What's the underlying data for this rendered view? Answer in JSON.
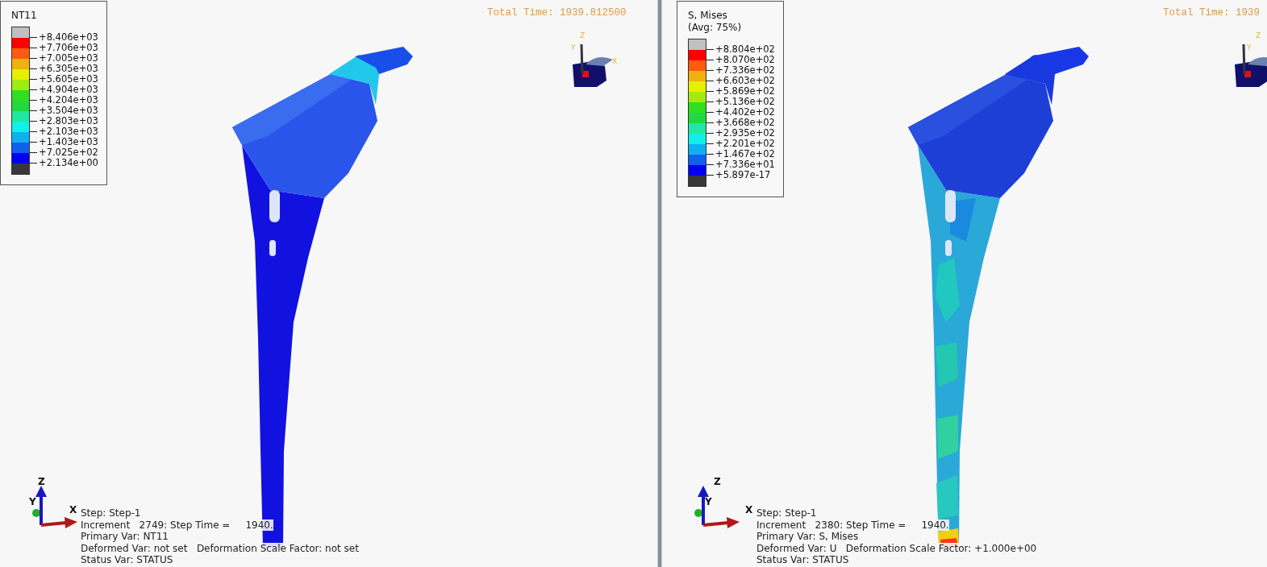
{
  "viewports": [
    {
      "kind": "temperature",
      "legend": {
        "title_lines": [
          "NT11"
        ],
        "bands": [
          {
            "color": "#c0c0c0"
          },
          {
            "color": "#ff0000"
          },
          {
            "color": "#ff5a10"
          },
          {
            "color": "#f0b010"
          },
          {
            "color": "#e4f000"
          },
          {
            "color": "#a0ec10"
          },
          {
            "color": "#30e020"
          },
          {
            "color": "#20d840"
          },
          {
            "color": "#20e8a0"
          },
          {
            "color": "#10f0e8"
          },
          {
            "color": "#10b0f0"
          },
          {
            "color": "#1060f0"
          },
          {
            "color": "#0000f0"
          },
          {
            "color": "#383838"
          }
        ],
        "ticks": [
          "+8.406e+03",
          "+7.706e+03",
          "+7.005e+03",
          "+6.305e+03",
          "+5.605e+03",
          "+4.904e+03",
          "+4.204e+03",
          "+3.504e+03",
          "+2.803e+03",
          "+2.103e+03",
          "+1.403e+03",
          "+7.025e+02",
          "+2.134e+00"
        ]
      },
      "header_lines": [
        "Total Time: 1939.812500"
      ],
      "view_cube_axes": [
        "Z",
        "Y",
        "X"
      ],
      "triad_axes": [
        "Z",
        "Y",
        "X"
      ],
      "info_lines": [
        "Step: Step-1",
        "Increment   2749: Step Time =     1940.",
        "Primary Var: NT11",
        "Deformed Var: not set   Deformation Scale Factor: not set",
        "Status Var: STATUS"
      ]
    },
    {
      "kind": "stress",
      "legend": {
        "title_lines": [
          "S, Mises",
          "(Avg: 75%)"
        ],
        "bands": [
          {
            "color": "#c0c0c0"
          },
          {
            "color": "#ff0000"
          },
          {
            "color": "#ff5a10"
          },
          {
            "color": "#f0b010"
          },
          {
            "color": "#e4f000"
          },
          {
            "color": "#a0ec10"
          },
          {
            "color": "#30e020"
          },
          {
            "color": "#20d840"
          },
          {
            "color": "#20e8a0"
          },
          {
            "color": "#10f0e8"
          },
          {
            "color": "#10b0f0"
          },
          {
            "color": "#1060f0"
          },
          {
            "color": "#0000f0"
          },
          {
            "color": "#383838"
          }
        ],
        "ticks": [
          "+8.804e+02",
          "+8.070e+02",
          "+7.336e+02",
          "+6.603e+02",
          "+5.869e+02",
          "+5.136e+02",
          "+4.402e+02",
          "+3.668e+02",
          "+2.935e+02",
          "+2.201e+02",
          "+1.467e+02",
          "+7.336e+01",
          "+5.897e-17"
        ]
      },
      "header_lines": [
        "Total Time: 1939"
      ],
      "view_cube_axes": [
        "Z",
        "Y"
      ],
      "triad_axes": [
        "Z",
        "Y",
        "X"
      ],
      "info_lines": [
        "Step: Step-1",
        "Increment   2380: Step Time =     1940.",
        "Primary Var: S, Mises",
        "Deformed Var: U   Deformation Scale Factor: +1.000e+00",
        "Status Var: STATUS"
      ]
    }
  ]
}
